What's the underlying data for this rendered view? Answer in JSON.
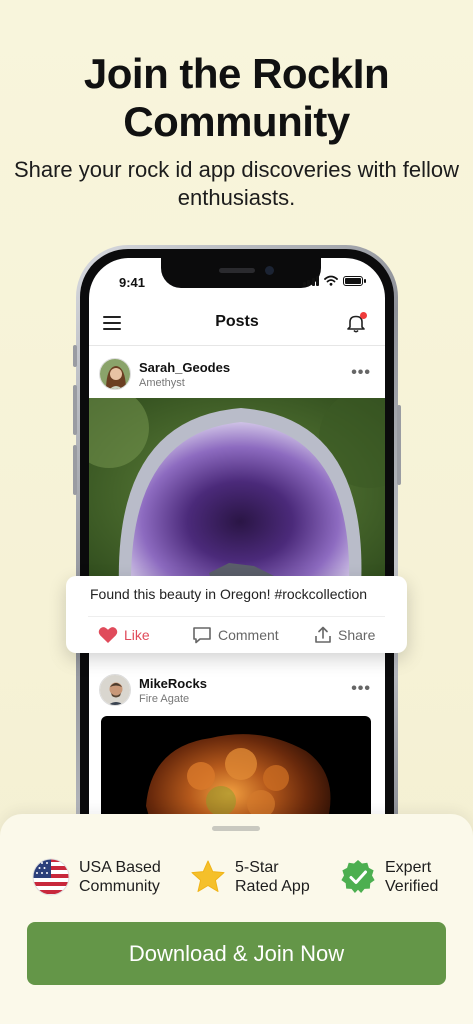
{
  "headline": "Join the RockIn Community",
  "subhead": "Share your rock id app discoveries with fellow enthusiasts.",
  "phone": {
    "status_time": "9:41",
    "header_title": "Posts",
    "posts": [
      {
        "username": "Sarah_Geodes",
        "rock": "Amethyst",
        "image": "amethyst-geode"
      },
      {
        "username": "MikeRocks",
        "rock": "Fire Agate",
        "image": "fire-agate"
      }
    ]
  },
  "caption_card": {
    "caption": "Found this beauty in Oregon! #rockcollection",
    "like_label": "Like",
    "comment_label": "Comment",
    "share_label": "Share"
  },
  "badges": [
    {
      "icon": "usa-flag-icon",
      "line1": "USA Based",
      "line2": "Community"
    },
    {
      "icon": "star-icon",
      "line1": "5-Star",
      "line2": "Rated App"
    },
    {
      "icon": "verified-check-icon",
      "line1": "Expert",
      "line2": "Verified"
    }
  ],
  "cta_label": "Download & Join Now",
  "colors": {
    "background": "#f8f5dc",
    "cta": "#649648",
    "like": "#e04b5b",
    "star": "#f5c02a",
    "verified": "#4caf50"
  }
}
